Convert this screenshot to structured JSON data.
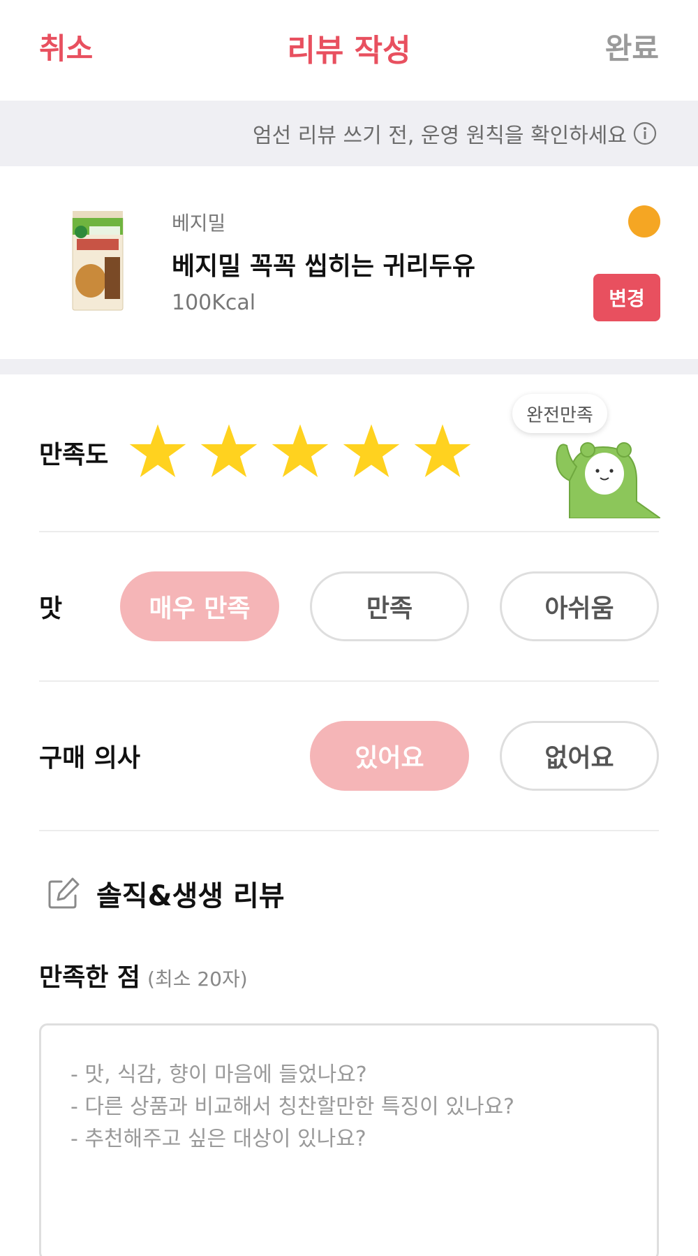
{
  "header": {
    "cancel_label": "취소",
    "title": "리뷰 작성",
    "done_label": "완료"
  },
  "notice": {
    "text": "엄선 리뷰 쓰기 전, 운영 원칙을 확인하세요",
    "icon": "info-icon"
  },
  "product": {
    "brand": "베지밀",
    "name": "베지밀 꼭꼭 씹히는 귀리두유",
    "calories": "100Kcal",
    "change_label": "변경",
    "status_dot_color": "#f5a623",
    "thumbnail_text": "베지밀 귀리두유"
  },
  "satisfaction": {
    "label": "만족도",
    "rating": 5,
    "max": 5,
    "badge": "완전만족",
    "star_color": "#ffd21f"
  },
  "taste": {
    "label": "맛",
    "options": [
      "매우 만족",
      "만족",
      "아쉬움"
    ],
    "selected": "매우 만족"
  },
  "repurchase": {
    "label": "구매 의사",
    "options": [
      "있어요",
      "없어요"
    ],
    "selected": "있어요"
  },
  "review": {
    "section_title": "솔직&생생 리뷰",
    "satisfied_label": "만족한 점",
    "satisfied_hint": "(최소 20자)",
    "placeholder": "- 맛, 식감, 향이 마음에 들었나요?\n- 다른 상품과 비교해서 칭찬할만한 특징이 있나요?\n- 추천해주고 싶은 대상이 있나요?"
  },
  "colors": {
    "accent": "#e8505f",
    "selected_pill": "#f5b5b7",
    "band": "#efeff3"
  }
}
